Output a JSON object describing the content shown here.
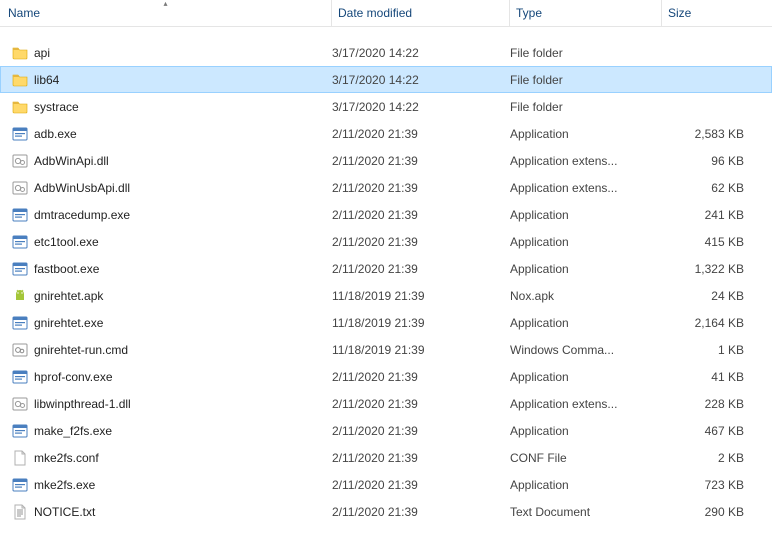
{
  "columns": {
    "name": "Name",
    "date": "Date modified",
    "type": "Type",
    "size": "Size"
  },
  "rows": [
    {
      "icon": "folder",
      "name": "api",
      "date": "3/17/2020 14:22",
      "type": "File folder",
      "size": "",
      "selected": false
    },
    {
      "icon": "folder",
      "name": "lib64",
      "date": "3/17/2020 14:22",
      "type": "File folder",
      "size": "",
      "selected": true
    },
    {
      "icon": "folder",
      "name": "systrace",
      "date": "3/17/2020 14:22",
      "type": "File folder",
      "size": "",
      "selected": false
    },
    {
      "icon": "exe",
      "name": "adb.exe",
      "date": "2/11/2020 21:39",
      "type": "Application",
      "size": "2,583 KB",
      "selected": false
    },
    {
      "icon": "dll",
      "name": "AdbWinApi.dll",
      "date": "2/11/2020 21:39",
      "type": "Application extens...",
      "size": "96 KB",
      "selected": false
    },
    {
      "icon": "dll",
      "name": "AdbWinUsbApi.dll",
      "date": "2/11/2020 21:39",
      "type": "Application extens...",
      "size": "62 KB",
      "selected": false
    },
    {
      "icon": "exe",
      "name": "dmtracedump.exe",
      "date": "2/11/2020 21:39",
      "type": "Application",
      "size": "241 KB",
      "selected": false
    },
    {
      "icon": "exe",
      "name": "etc1tool.exe",
      "date": "2/11/2020 21:39",
      "type": "Application",
      "size": "415 KB",
      "selected": false
    },
    {
      "icon": "exe",
      "name": "fastboot.exe",
      "date": "2/11/2020 21:39",
      "type": "Application",
      "size": "1,322 KB",
      "selected": false
    },
    {
      "icon": "apk",
      "name": "gnirehtet.apk",
      "date": "11/18/2019 21:39",
      "type": "Nox.apk",
      "size": "24 KB",
      "selected": false
    },
    {
      "icon": "exe",
      "name": "gnirehtet.exe",
      "date": "11/18/2019 21:39",
      "type": "Application",
      "size": "2,164 KB",
      "selected": false
    },
    {
      "icon": "cmd",
      "name": "gnirehtet-run.cmd",
      "date": "11/18/2019 21:39",
      "type": "Windows Comma...",
      "size": "1 KB",
      "selected": false
    },
    {
      "icon": "exe",
      "name": "hprof-conv.exe",
      "date": "2/11/2020 21:39",
      "type": "Application",
      "size": "41 KB",
      "selected": false
    },
    {
      "icon": "dll",
      "name": "libwinpthread-1.dll",
      "date": "2/11/2020 21:39",
      "type": "Application extens...",
      "size": "228 KB",
      "selected": false
    },
    {
      "icon": "exe",
      "name": "make_f2fs.exe",
      "date": "2/11/2020 21:39",
      "type": "Application",
      "size": "467 KB",
      "selected": false
    },
    {
      "icon": "file",
      "name": "mke2fs.conf",
      "date": "2/11/2020 21:39",
      "type": "CONF File",
      "size": "2 KB",
      "selected": false
    },
    {
      "icon": "exe",
      "name": "mke2fs.exe",
      "date": "2/11/2020 21:39",
      "type": "Application",
      "size": "723 KB",
      "selected": false
    },
    {
      "icon": "txt",
      "name": "NOTICE.txt",
      "date": "2/11/2020 21:39",
      "type": "Text Document",
      "size": "290 KB",
      "selected": false
    }
  ]
}
